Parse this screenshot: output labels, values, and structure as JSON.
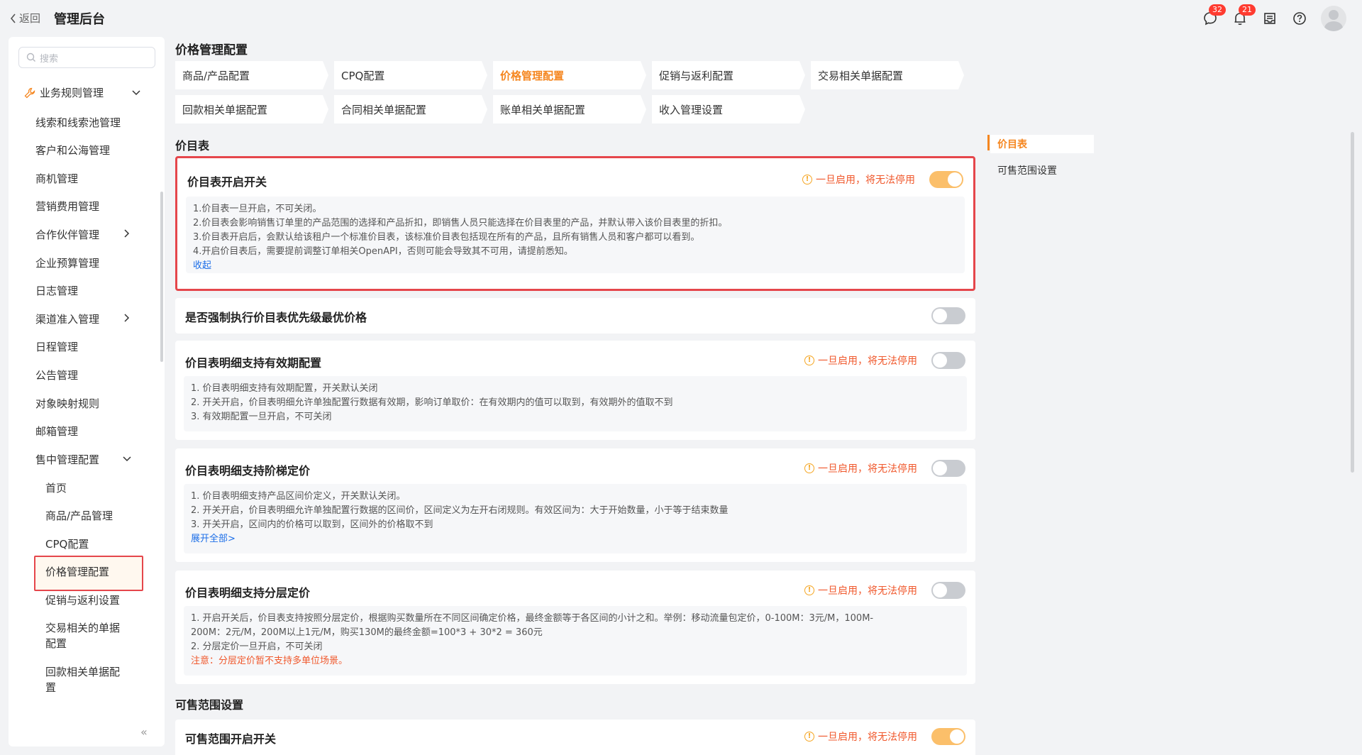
{
  "header": {
    "back_label": "返回",
    "app_title": "管理后台",
    "message_badge": "32",
    "notification_badge": "21"
  },
  "sidebar": {
    "search_placeholder": "搜索",
    "group_label": "业务规则管理",
    "items": [
      "线索和线索池管理",
      "客户和公海管理",
      "商机管理",
      "营销费用管理",
      "合作伙伴管理",
      "企业预算管理",
      "日志管理",
      "渠道准入管理",
      "日程管理",
      "公告管理",
      "对象映射规则",
      "邮箱管理",
      "售中管理配置"
    ],
    "sub_items": [
      "首页",
      "商品/产品管理",
      "CPQ配置",
      "价格管理配置",
      "促销与返利设置",
      "交易相关的单据",
      "配置",
      "回款相关单据配",
      "置"
    ],
    "collapse_label": "«"
  },
  "main": {
    "title": "价格管理配置",
    "tabs": [
      "商品/产品配置",
      "CPQ配置",
      "价格管理配置",
      "促销与返利配置",
      "交易相关单据配置",
      "回款相关单据配置",
      "合同相关单据配置",
      "账单相关单据配置",
      "收入管理设置"
    ],
    "section_pricebook": "价目表",
    "section_saleable": "可售范围设置",
    "warning_text": "一旦启用，将无法停用",
    "cards": {
      "c1": {
        "title": "价目表开启开关",
        "lines": [
          "1.价目表一旦开启，不可关闭。",
          "2.价目表会影响销售订单里的产品范围的选择和产品折扣，即销售人员只能选择在价目表里的产品，并默认带入该价目表里的折扣。",
          "3.价目表开启后，会默认给该租户一个标准价目表，该标准价目表包括现在所有的产品，且所有销售人员和客户都可以看到。",
          "4.开启价目表后，需要提前调整订单相关OpenAPI，否则可能会导致其不可用，请提前悉知。"
        ],
        "link": "收起"
      },
      "c2": {
        "title": "是否强制执行价目表优先级最优价格"
      },
      "c3": {
        "title": "价目表明细支持有效期配置",
        "lines": [
          "1. 价目表明细支持有效期配置，开关默认关闭",
          "2. 开关开启，价目表明细允许单独配置行数据有效期，影响订单取价：在有效期内的值可以取到，有效期外的值取不到",
          "3. 有效期配置一旦开启，不可关闭"
        ]
      },
      "c4": {
        "title": "价目表明细支持阶梯定价",
        "lines": [
          "1. 价目表明细支持产品区间价定义，开关默认关闭。",
          "2. 开关开启，价目表明细允许单独配置行数据的区间价，区间定义为左开右闭规则。有效区间为：大于开始数量，小于等于结束数量",
          "3. 开关开启，区间内的价格可以取到，区间外的价格取不到"
        ],
        "link": "展开全部>"
      },
      "c5": {
        "title": "价目表明细支持分层定价",
        "lines": [
          "1. 开启开关后，价目表支持按照分层定价，根据购买数量所在不同区间确定价格，最终金额等于各区间的小计之和。举例：移动流量包定价，0-100M：3元/M，100M-",
          "200M：2元/M，200M以上1元/M，购买130M的最终金额=100*3 + 30*2 = 360元",
          "2. 分层定价一旦开启，不可关闭"
        ],
        "note": "注意：分层定价暂不支持多单位场景。"
      },
      "c6": {
        "title": "可售范围开启开关"
      }
    }
  },
  "anchor_nav": {
    "items": [
      "价目表",
      "可售范围设置"
    ]
  },
  "colors": {
    "accent": "#f5861f",
    "highlight_border": "#e5464b",
    "warning": "#f0582c",
    "link": "#1d6fe8",
    "toggle_on": "#fbbf6a",
    "toggle_off": "#c9ccd1"
  }
}
